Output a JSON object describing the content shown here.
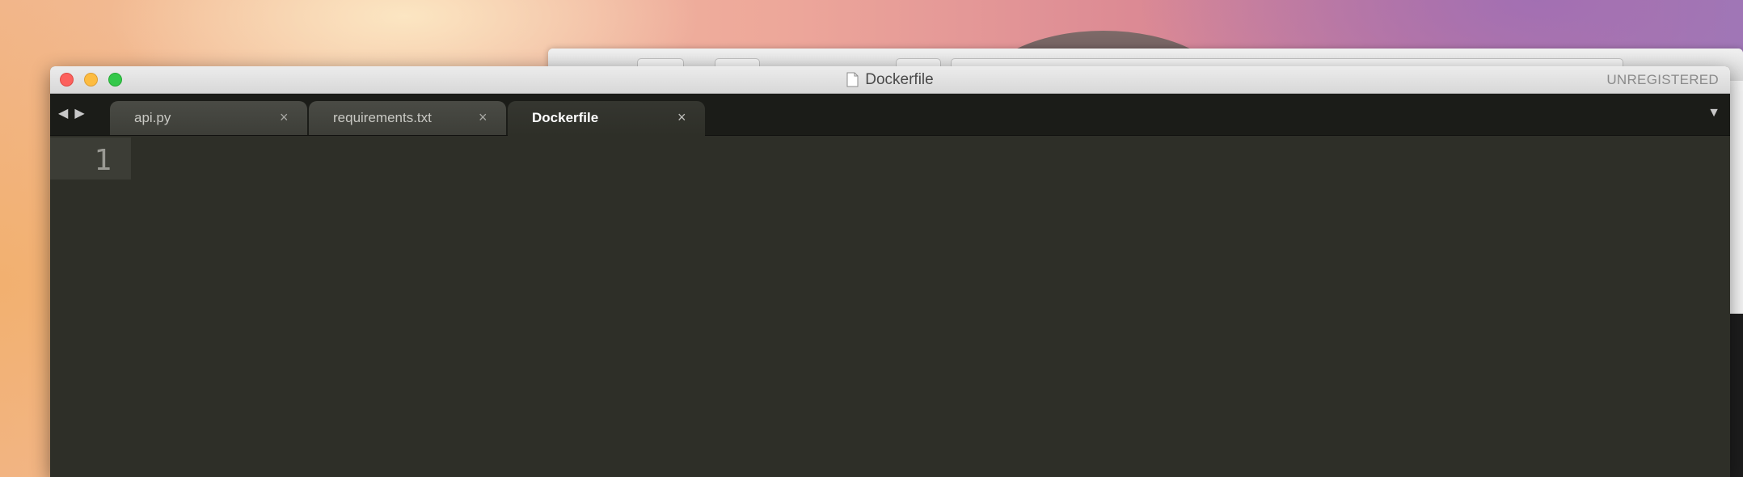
{
  "window": {
    "title": "Dockerfile",
    "license_status": "UNREGISTERED"
  },
  "nav": {
    "back_icon": "◀",
    "forward_icon": "▶"
  },
  "tabs": [
    {
      "label": "api.py",
      "close_icon": "×",
      "active": false
    },
    {
      "label": "requirements.txt",
      "close_icon": "×",
      "active": false
    },
    {
      "label": "Dockerfile",
      "close_icon": "×",
      "active": true
    }
  ],
  "tab_dropdown_icon": "▼",
  "editor": {
    "line_numbers": [
      "1"
    ],
    "content": ""
  },
  "colors": {
    "editor_background": "#2e2f28",
    "tabbar_background": "#1b1c18",
    "close_button": "#fc605c",
    "minimize_button": "#fdbc40",
    "zoom_button": "#34c84a"
  }
}
